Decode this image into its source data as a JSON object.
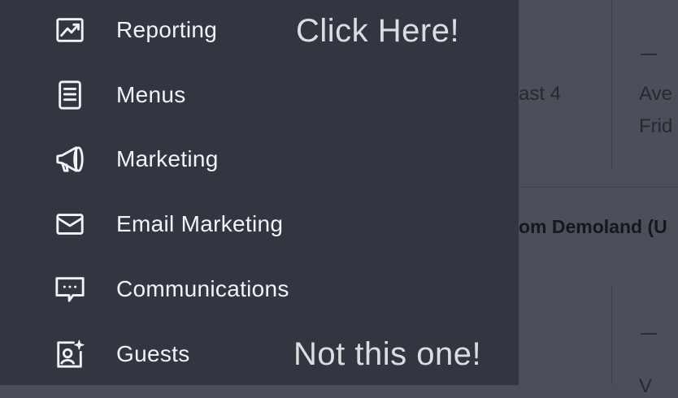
{
  "background": {
    "text_a": "ast 4",
    "text_b": "Ave",
    "text_c": "Frid",
    "text_d": "om Demoland (U",
    "text_e": "V"
  },
  "sidebar": {
    "items": [
      {
        "label": "Reporting",
        "icon": "chart-trend-icon"
      },
      {
        "label": "Menus",
        "icon": "document-icon"
      },
      {
        "label": "Marketing",
        "icon": "megaphone-icon"
      },
      {
        "label": "Email Marketing",
        "icon": "envelope-icon"
      },
      {
        "label": "Communications",
        "icon": "chat-bubble-icon"
      },
      {
        "label": "Guests",
        "icon": "guest-profile-icon"
      }
    ]
  },
  "annotations": {
    "click_here": "Click Here!",
    "not_this": "Not this one!"
  },
  "colors": {
    "drawer_bg": "#333640",
    "overlay_bg": "#4b4f5a",
    "label_text": "#f2f3f5"
  }
}
